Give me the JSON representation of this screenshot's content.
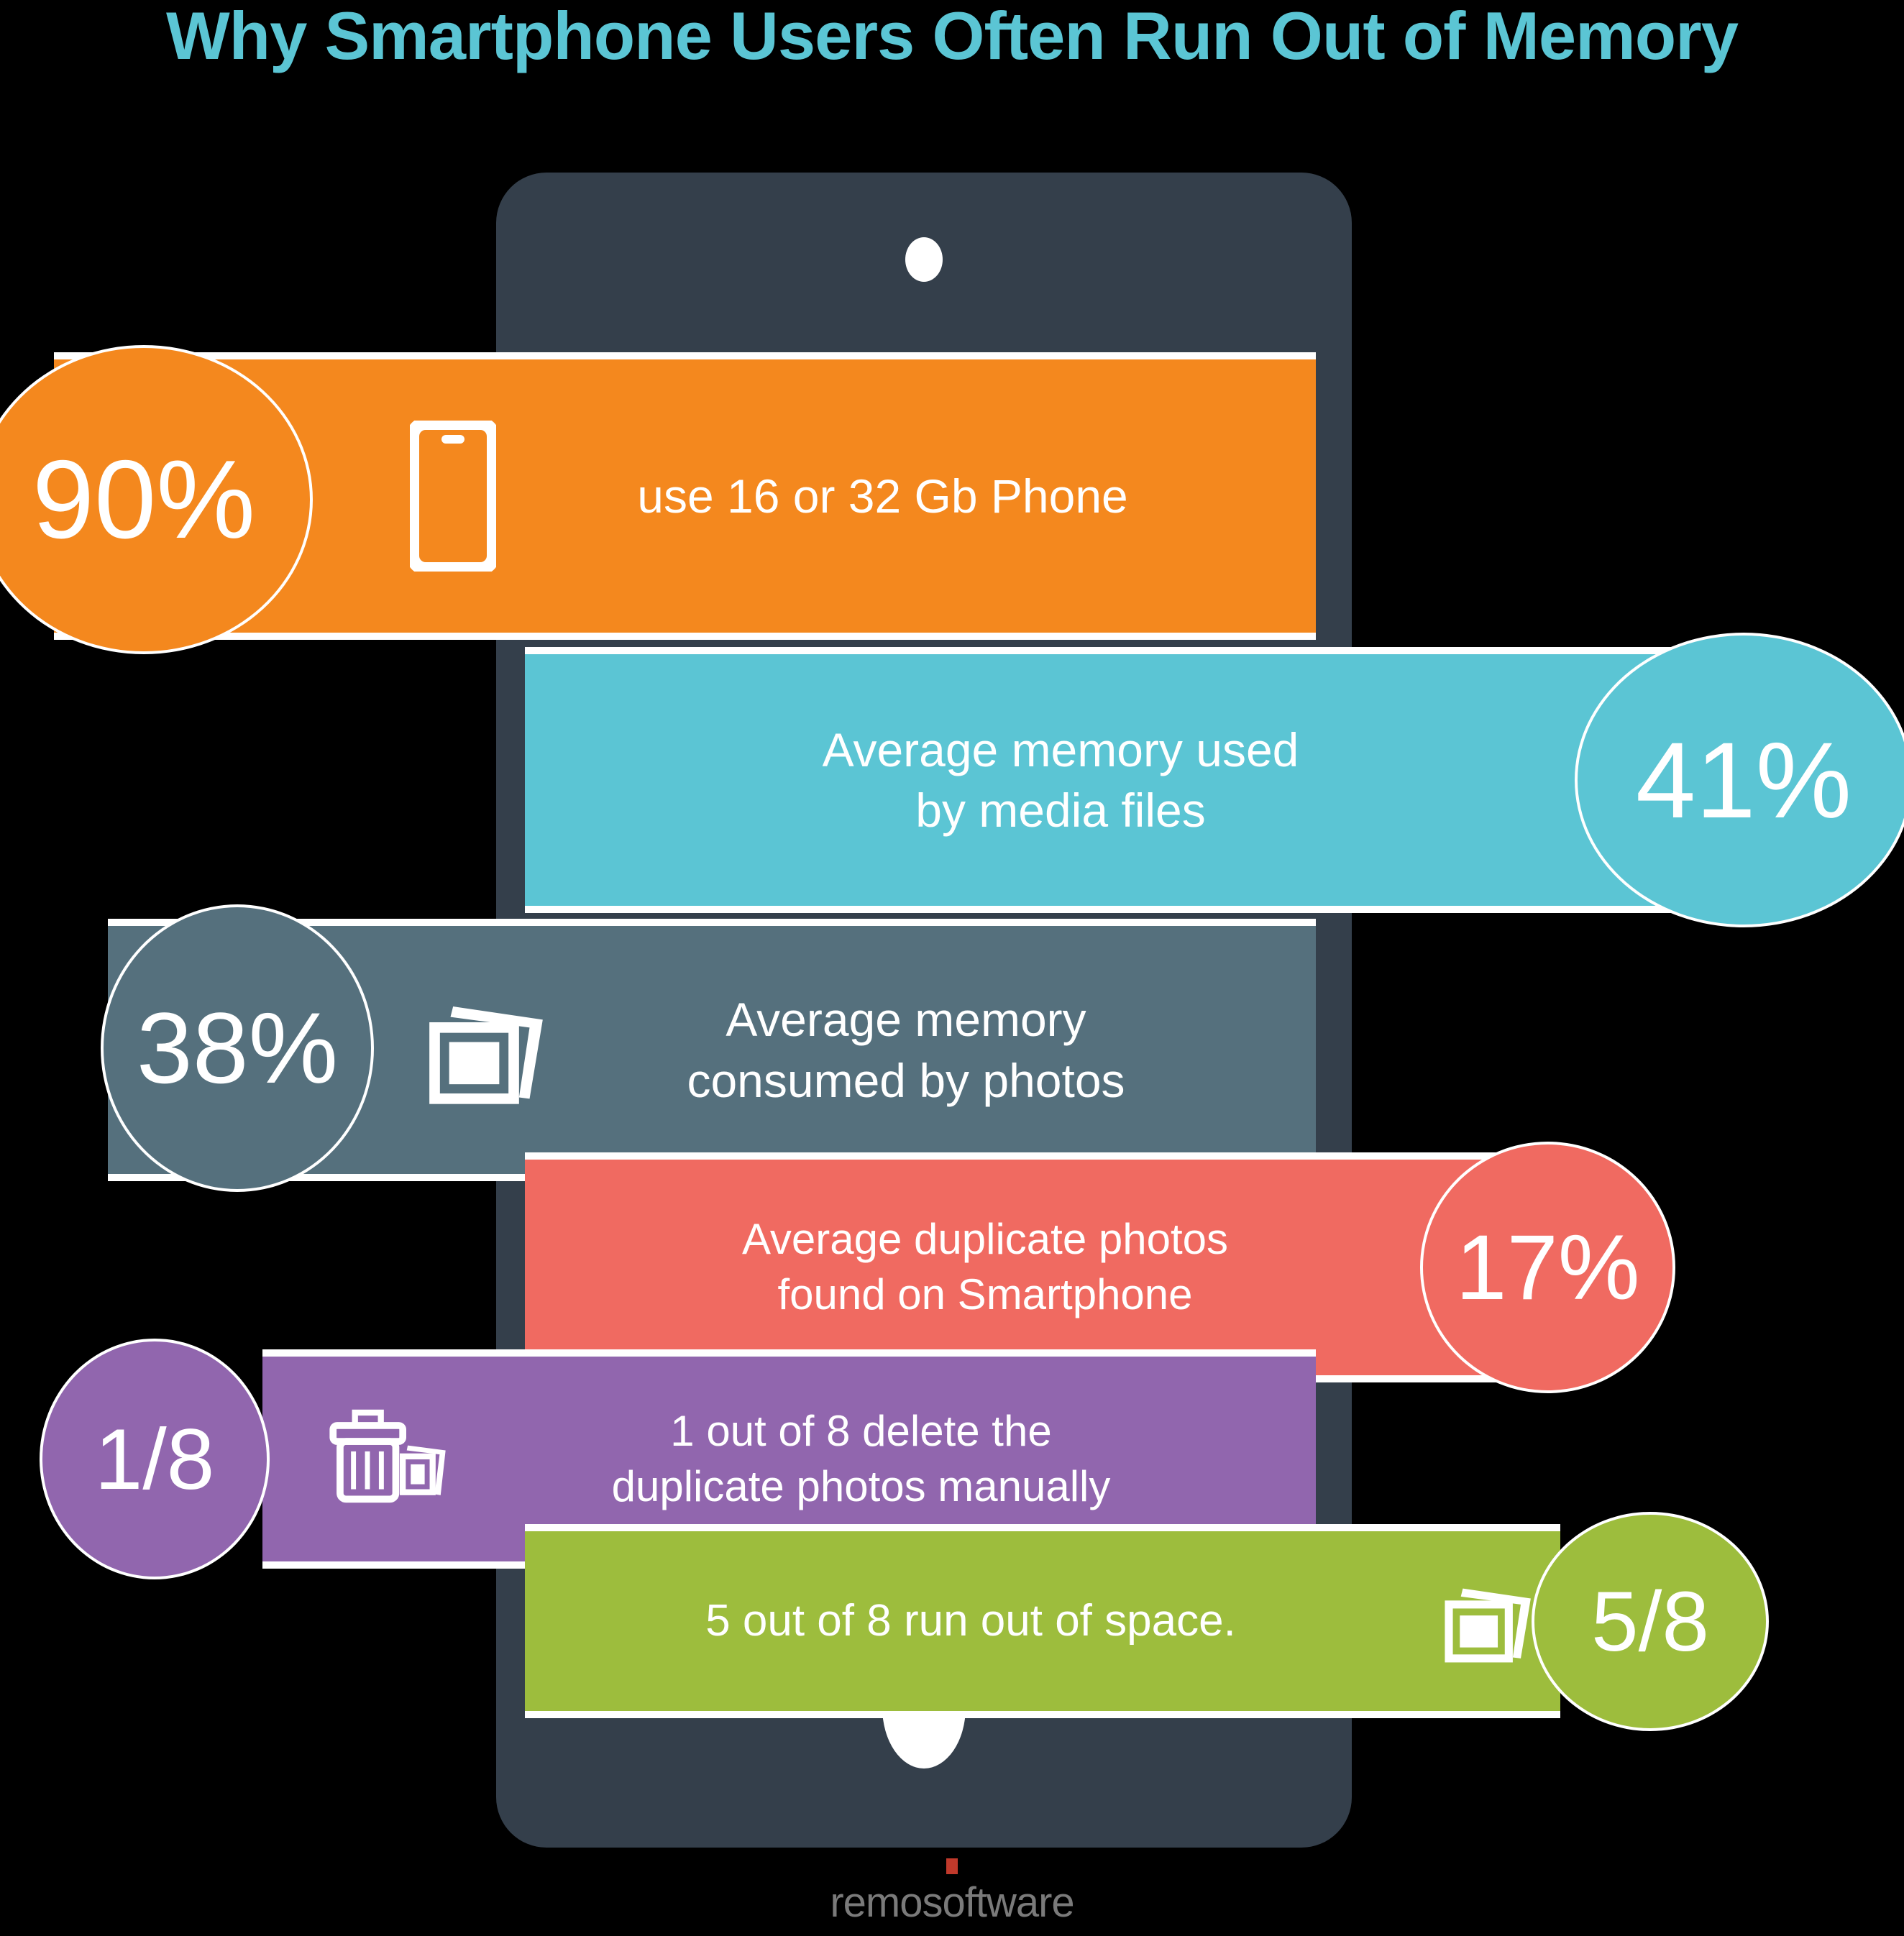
{
  "title": "Why Smartphone Users Often Run Out of Memory",
  "colors": {
    "background": "#000000",
    "title": "#5BC5D4",
    "phone_body": "#343F4B",
    "orange": "#F4881E",
    "teal": "#5BC5D4",
    "slate": "#55707D",
    "red": "#F06A61",
    "purple": "#9166AE",
    "green": "#9DBD3D",
    "white": "#FFFFFF",
    "logo_accent": "#C0392B",
    "logo_text": "#7A7A7A"
  },
  "phone": {
    "camera_icon": "front-camera-dot",
    "speaker_icon": "earpiece-speaker-grille",
    "home_icon": "home-button"
  },
  "rows": [
    {
      "id": "use-16-or-32-gb-phone",
      "value": "90%",
      "label": "use 16 or 32 Gb Phone",
      "color": "#F4881E",
      "bubble_side": "left",
      "icon": "smartphone-icon"
    },
    {
      "id": "average-memory-used-by-media-files",
      "value": "41%",
      "label": "Average memory used\nby media files",
      "color": "#5BC5D4",
      "bubble_side": "right",
      "icon": "photo-stack-icon"
    },
    {
      "id": "average-memory-consumed-by-photos",
      "value": "38%",
      "label": "Average memory\nconsumed by photos",
      "color": "#55707D",
      "bubble_side": "left",
      "icon": "photo-stack-icon"
    },
    {
      "id": "average-duplicate-photos-found-on-smartphone",
      "value": "17%",
      "label": "Average duplicate photos\nfound on Smartphone",
      "color": "#F06A61",
      "bubble_side": "right",
      "icon": "photo-stack-icon"
    },
    {
      "id": "delete-duplicate-photos-manually",
      "value": "1/8",
      "label": "1 out of 8 delete the\nduplicate photos manually",
      "color": "#9166AE",
      "bubble_side": "left",
      "icon": "trash-with-photos-icon"
    },
    {
      "id": "run-out-of-space",
      "value": "5/8",
      "label": "5 out of 8 run out of space.",
      "color": "#9DBD3D",
      "bubble_side": "right",
      "icon": "photo-stack-icon"
    }
  ],
  "footer": {
    "brand": "remosoftware",
    "accent_icon": "red-square-mark"
  },
  "chart_data": {
    "type": "bar",
    "title": "Why Smartphone Users Often Run Out of Memory",
    "xlabel": "",
    "ylabel": "",
    "categories": [
      "use 16 or 32 Gb Phone",
      "Average memory used by media files",
      "Average memory consumed by photos",
      "Average duplicate photos found on Smartphone",
      "1 out of 8 delete the duplicate photos manually",
      "5 out of 8 run out of space."
    ],
    "values": [
      90,
      41,
      38,
      17,
      12.5,
      62.5
    ],
    "value_labels": [
      "90%",
      "41%",
      "38%",
      "17%",
      "1/8",
      "5/8"
    ],
    "colors": [
      "#F4881E",
      "#5BC5D4",
      "#55707D",
      "#F06A61",
      "#9166AE",
      "#9DBD3D"
    ],
    "ylim": [
      0,
      100
    ],
    "grid": false,
    "legend": "none"
  }
}
